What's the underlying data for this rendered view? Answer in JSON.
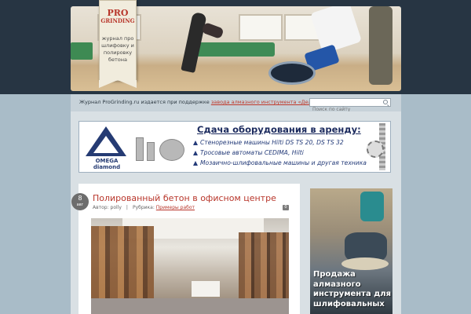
{
  "header": {
    "logo": {
      "line1": "PRO",
      "line2": "GRINDING"
    },
    "tagline": "журнал про шлифовку и полировку бетона"
  },
  "infobar": {
    "text": "Журнал ProGrinding.ru издается при поддержке ",
    "link": "завода алмазного инструмента «Дельта»",
    "search_placeholder": "Поиск по сайту"
  },
  "banner": {
    "brand_line1": "OMEGA",
    "brand_line2": "diamond",
    "title": "Сдача оборудования в аренду:",
    "items": [
      "Стенорезные машины Hilti DS TS 20, DS TS 32",
      "Тросовые автоматы CEDIMA, Hilti",
      "Мозаично-шлифовальные машины и другая техника"
    ]
  },
  "post": {
    "date_day": "8",
    "date_month": "авг",
    "title": "Полированный бетон в офисном центре",
    "author_label": "Автор: polly",
    "rubric_label": "Рубрика:",
    "rubric_link": "Примеры работ",
    "separator": "|",
    "comments_count": "0"
  },
  "sidebar": {
    "ad_text": "Продажа алмазного инструмента для шлифовальных"
  }
}
